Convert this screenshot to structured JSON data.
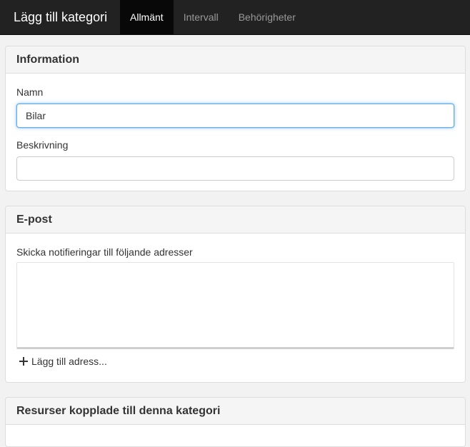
{
  "navbar": {
    "brand": "Lägg till kategori",
    "tabs": [
      {
        "label": "Allmänt",
        "active": true
      },
      {
        "label": "Intervall",
        "active": false
      },
      {
        "label": "Behörigheter",
        "active": false
      }
    ]
  },
  "information": {
    "heading": "Information",
    "name_label": "Namn",
    "name_value": "Bilar",
    "description_label": "Beskrivning",
    "description_value": ""
  },
  "email": {
    "heading": "E-post",
    "notify_label": "Skicka notifieringar till följande adresser",
    "add_address": "Lägg till adress...",
    "add_icon": "plus-icon"
  },
  "resources": {
    "heading": "Resurser kopplade till denna kategori"
  },
  "colors": {
    "navbar_bg": "#222222",
    "active_tab_bg": "#080808",
    "focus_border": "#66afe9"
  }
}
